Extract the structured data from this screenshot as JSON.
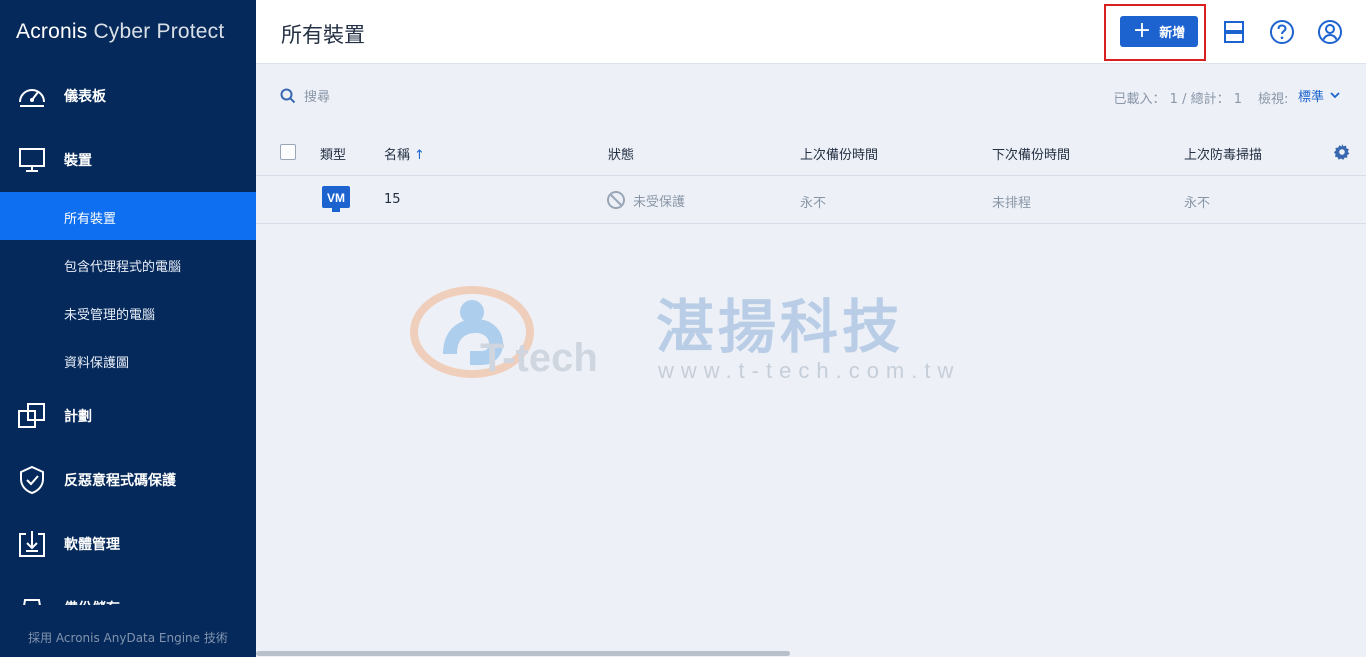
{
  "app": {
    "brand_main": "Acronis",
    "brand_sub": "Cyber Protect"
  },
  "sidebar": {
    "items": [
      {
        "label": "儀表板",
        "icon": "dashboard-icon"
      },
      {
        "label": "裝置",
        "icon": "monitor-icon"
      },
      {
        "label": "計劃",
        "icon": "plans-icon"
      },
      {
        "label": "反惡意程式碼保護",
        "icon": "shield-icon"
      },
      {
        "label": "軟體管理",
        "icon": "software-icon"
      },
      {
        "label": "備份儲存",
        "icon": "storage-icon"
      }
    ],
    "sub_items": [
      {
        "label": "所有裝置",
        "active": true
      },
      {
        "label": "包含代理程式的電腦",
        "active": false
      },
      {
        "label": "未受管理的電腦",
        "active": false
      },
      {
        "label": "資料保護圖",
        "active": false
      }
    ],
    "footer": "採用 Acronis AnyData Engine 技術"
  },
  "header": {
    "title": "所有裝置",
    "add_label": "新增",
    "add_symbol": "+"
  },
  "toolbar": {
    "search_placeholder": "搜尋",
    "loaded_text": "已載入： 1 / 總計： 1",
    "view_label": "檢視:",
    "view_value": "標準"
  },
  "table": {
    "columns": {
      "type": "類型",
      "name": "名稱",
      "status": "狀態",
      "last_backup": "上次備份時間",
      "next_backup": "下次備份時間",
      "last_scan": "上次防毒掃描"
    },
    "sort_indicator": "↑",
    "rows": [
      {
        "type_badge": "VM",
        "name": "15",
        "status": "未受保護",
        "last_backup": "永不",
        "next_backup": "未排程",
        "last_scan": "永不"
      }
    ]
  },
  "watermark": {
    "cn": "湛揚科技",
    "logo_text": "T-tech",
    "url": "www.t-tech.com.tw"
  },
  "colors": {
    "sidebar_bg": "#05295a",
    "active_item": "#0e6ff0",
    "accent": "#1c63d0",
    "highlight_box": "#d92020"
  }
}
